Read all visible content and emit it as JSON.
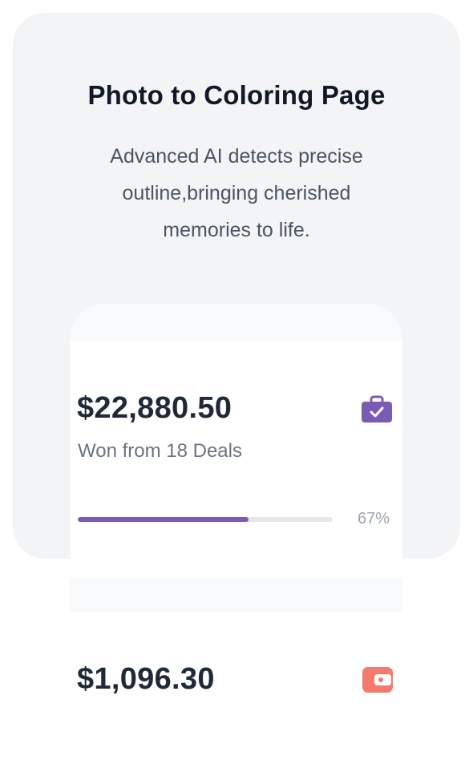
{
  "feature": {
    "title": "Photo to Coloring Page",
    "description": "Advanced AI detects precise outline,bringing cherished memories to life."
  },
  "preview": {
    "stat1": {
      "amount": "$22,880.50",
      "subtitle": "Won from 18 Deals",
      "progress_label": "67%",
      "progress_value": 0.67,
      "icon": "briefcase-check-icon",
      "icon_color": "#7b5ab6"
    },
    "stat2": {
      "amount": "$1,096.30",
      "icon": "wallet-icon",
      "icon_color": "#f27a6e"
    }
  },
  "colors": {
    "card_bg": "#f3f4f6",
    "accent": "#7b5ab6",
    "track": "#e5e7eb"
  }
}
